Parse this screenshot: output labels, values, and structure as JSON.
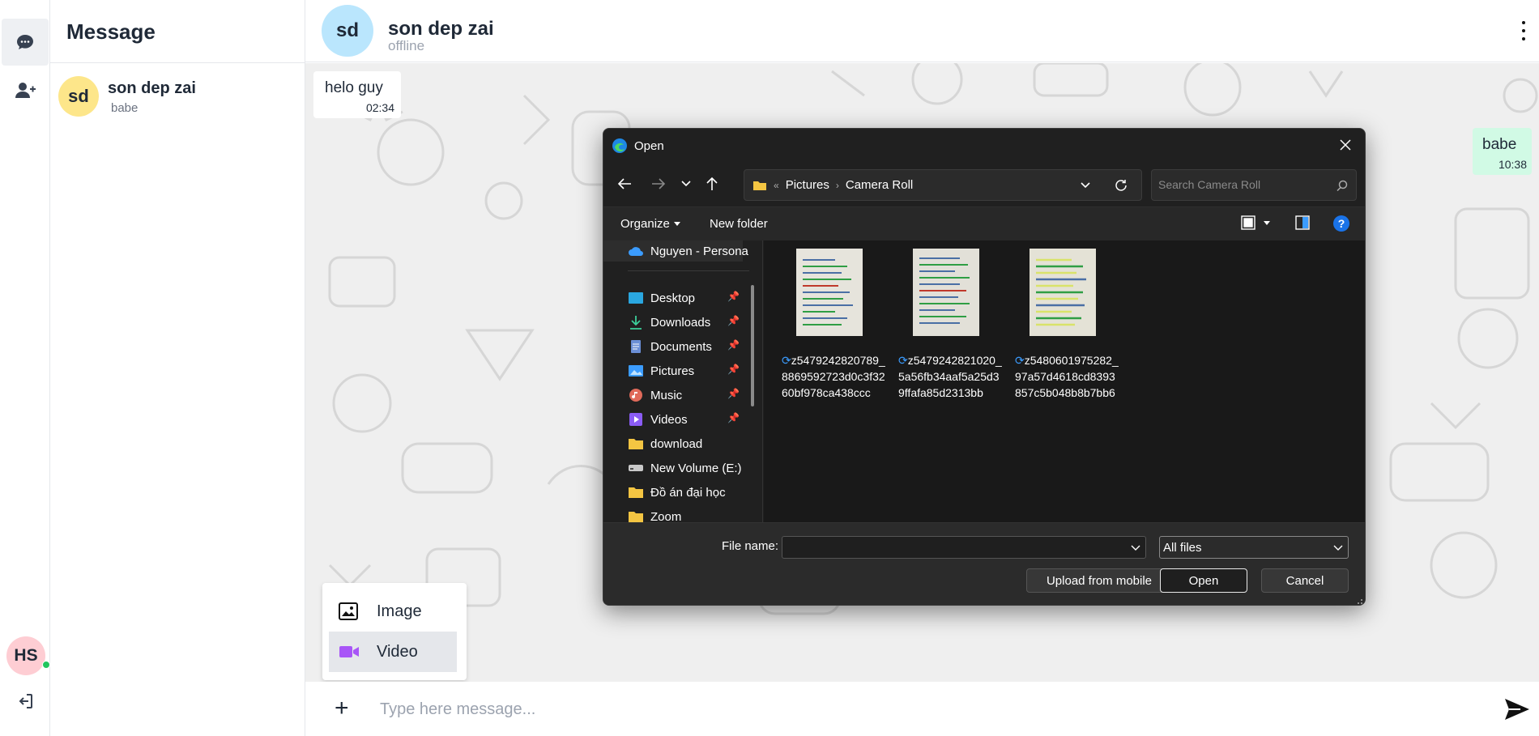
{
  "sidebar": {
    "title": "Message",
    "user_initials": "HS"
  },
  "conversations": [
    {
      "initials": "sd",
      "name": "son dep zai",
      "last_message": "babe"
    }
  ],
  "chat": {
    "contact_initials": "sd",
    "contact_name": "son dep zai",
    "contact_status": "offline",
    "messages": [
      {
        "direction": "in",
        "text": "helo guy",
        "time": "02:34"
      },
      {
        "direction": "out",
        "text": "babe",
        "time": "10:38"
      }
    ],
    "attach_menu": {
      "image_label": "Image",
      "video_label": "Video"
    },
    "input_placeholder": "Type here message..."
  },
  "dialog": {
    "title": "Open",
    "breadcrumb": [
      "Pictures",
      "Camera Roll"
    ],
    "search_placeholder": "Search Camera Roll",
    "toolbar": {
      "organize": "Organize",
      "new_folder": "New folder"
    },
    "nav_items": [
      {
        "label": "Nguyen - Persona",
        "icon": "onedrive-icon",
        "pinned": false
      },
      {
        "label": "Desktop",
        "icon": "desktop-icon",
        "pinned": true
      },
      {
        "label": "Downloads",
        "icon": "downloads-icon",
        "pinned": true
      },
      {
        "label": "Documents",
        "icon": "documents-icon",
        "pinned": true
      },
      {
        "label": "Pictures",
        "icon": "pictures-icon",
        "pinned": true
      },
      {
        "label": "Music",
        "icon": "music-icon",
        "pinned": true
      },
      {
        "label": "Videos",
        "icon": "videos-icon",
        "pinned": true
      },
      {
        "label": "download",
        "icon": "folder-icon",
        "pinned": false
      },
      {
        "label": "New Volume (E:)",
        "icon": "drive-icon",
        "pinned": false
      },
      {
        "label": "Đồ án đại học",
        "icon": "folder-icon",
        "pinned": false
      },
      {
        "label": "Zoom",
        "icon": "folder-icon",
        "pinned": false
      }
    ],
    "files": [
      {
        "name": "z5479242820789_8869592723d0c3f3260bf978ca438ccc"
      },
      {
        "name": "z5479242821020_5a56fb34aaf5a25d39ffafa85d2313bb"
      },
      {
        "name": "z5480601975282_97a57d4618cd8393857c5b048b8b7bb6"
      }
    ],
    "file_name_label": "File name:",
    "file_name_value": "",
    "file_type": "All files",
    "buttons": {
      "upload_mobile": "Upload from mobile",
      "open": "Open",
      "cancel": "Cancel"
    }
  },
  "colors": {
    "avatar_user": "#fecdd3",
    "avatar_contact_list": "#fde68a",
    "avatar_contact_header": "#bae6fd",
    "outgoing_bubble": "#d1fae5",
    "online": "#22c55e",
    "video_icon": "#a855f7",
    "dialog_bg": "#202020",
    "help_blue": "#1a73e8"
  }
}
